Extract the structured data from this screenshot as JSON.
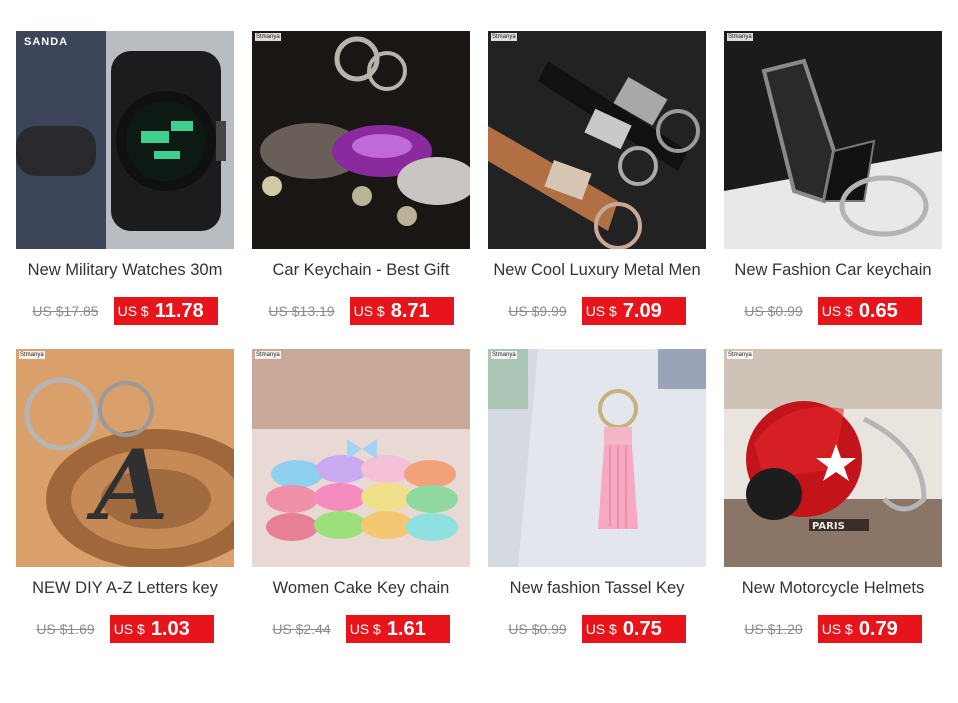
{
  "products": [
    {
      "title": "New Military Watches 30m",
      "old_price": "US $17.85",
      "currency": "US $",
      "price": "11.78",
      "watermark": "SANDA",
      "image_icon": "watch-image"
    },
    {
      "title": "Car Keychain - Best Gift",
      "old_price": "US $13.19",
      "currency": "US $",
      "price": "8.71",
      "watermark": "Stmanya",
      "image_icon": "car-keychain-image"
    },
    {
      "title": "New Cool Luxury Metal Men",
      "old_price": "US $9.99",
      "currency": "US $",
      "price": "7.09",
      "watermark": "Stmanya",
      "image_icon": "leather-keychain-image"
    },
    {
      "title": "New Fashion Car keychain",
      "old_price": "US $0.99",
      "currency": "US $",
      "price": "0.65",
      "watermark": "Stmanya",
      "image_icon": "metal-keychain-image"
    },
    {
      "title": "NEW DIY A-Z Letters key",
      "old_price": "US $1.69",
      "currency": "US $",
      "price": "1.03",
      "watermark": "Stmanya",
      "image_icon": "letter-keychain-image"
    },
    {
      "title": "Women Cake Key chain",
      "old_price": "US $2.44",
      "currency": "US $",
      "price": "1.61",
      "watermark": "Stmanya",
      "image_icon": "macaron-keychain-image"
    },
    {
      "title": "New fashion Tassel Key",
      "old_price": "US $0.99",
      "currency": "US $",
      "price": "0.75",
      "watermark": "Stmanya",
      "image_icon": "tassel-keychain-image"
    },
    {
      "title": "New Motorcycle Helmets",
      "old_price": "US $1.20",
      "currency": "US $",
      "price": "0.79",
      "watermark": "Stmanya",
      "image_icon": "helmet-keychain-image"
    }
  ],
  "colors": {
    "sale_badge": "#e8141b",
    "old_price": "#8c8c8c",
    "title": "#333333"
  }
}
